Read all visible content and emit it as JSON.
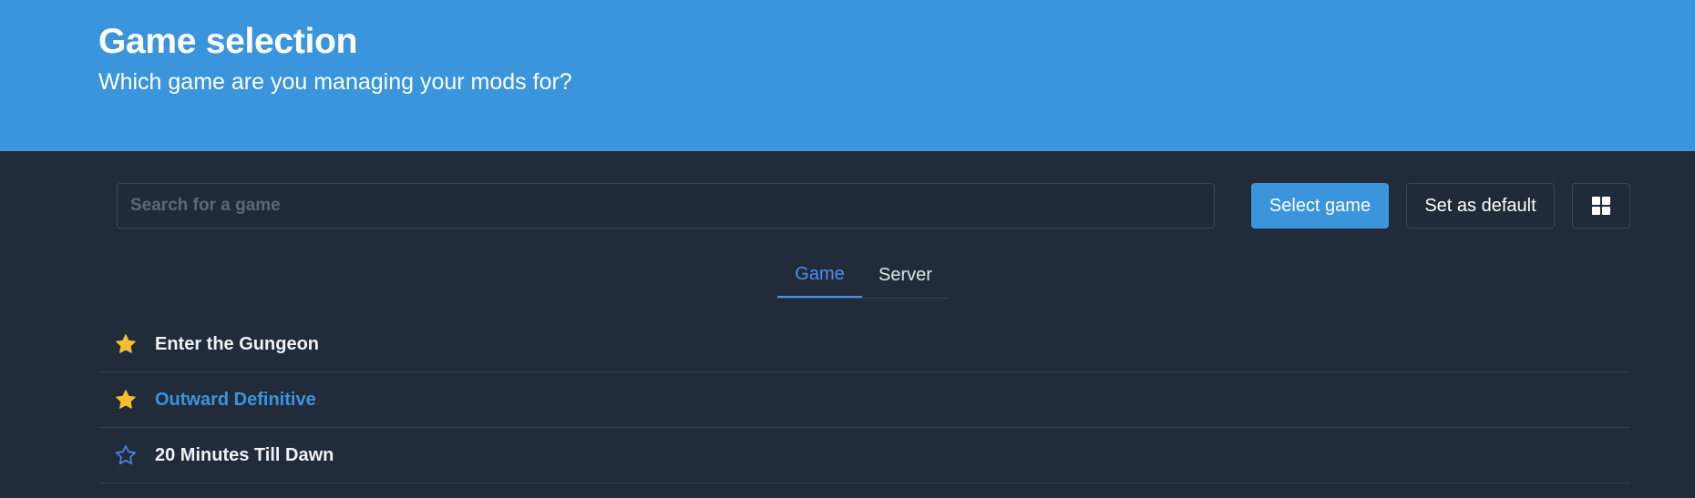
{
  "header": {
    "title": "Game selection",
    "subtitle": "Which game are you managing your mods for?"
  },
  "toolbar": {
    "search_placeholder": "Search for a game",
    "search_value": "",
    "select_label": "Select game",
    "default_label": "Set as default",
    "view_icon": "grid-view-icon"
  },
  "tabs": [
    {
      "label": "Game",
      "active": true
    },
    {
      "label": "Server",
      "active": false
    }
  ],
  "games": [
    {
      "name": "Enter the Gungeon",
      "favorite": true,
      "highlighted": false
    },
    {
      "name": "Outward Definitive",
      "favorite": true,
      "highlighted": true
    },
    {
      "name": "20 Minutes Till Dawn",
      "favorite": false,
      "highlighted": false
    }
  ],
  "colors": {
    "header_bg": "#3b95dc",
    "body_bg": "#212b3a",
    "accent": "#3b95dc",
    "tab_active": "#4a90ec",
    "star_filled": "#f5be2f",
    "star_outline": "#4a7fe8"
  }
}
